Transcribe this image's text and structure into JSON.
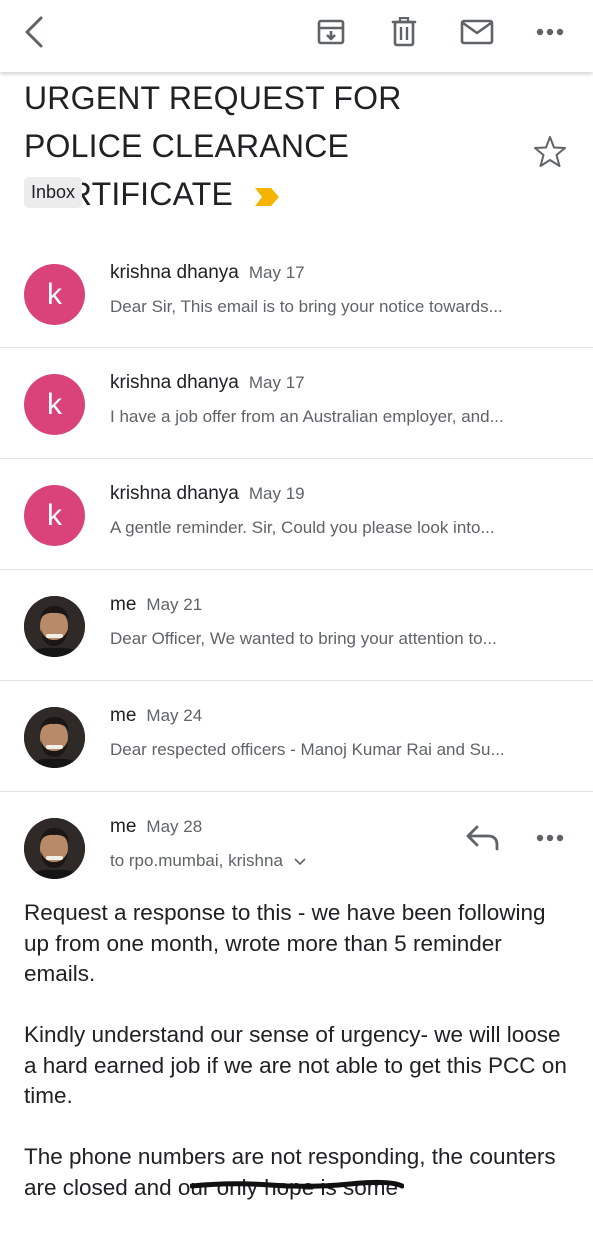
{
  "toolbar": {
    "back": "back-arrow-icon",
    "archive": "archive-icon",
    "delete": "trash-icon",
    "mark_unread": "mail-icon",
    "more": "more-horizontal-icon"
  },
  "email": {
    "subject": "URGENT REQUEST FOR POLICE CLEARANCE CERTIFICATE",
    "label": "Inbox",
    "important_color": "#f4b400",
    "avatar_color": "#d9437a"
  },
  "thread": [
    {
      "sender": "krishna dhanya",
      "date": "May 17",
      "snippet": "Dear Sir, This email is to bring your notice towards...",
      "initial": "k"
    },
    {
      "sender": "krishna dhanya",
      "date": "May 17",
      "snippet": "I have a job offer from an Australian employer, and...",
      "initial": "k"
    },
    {
      "sender": "krishna dhanya",
      "date": "May 19",
      "snippet": "A gentle reminder. Sir, Could you please look into...",
      "initial": "k"
    },
    {
      "sender": "me",
      "date": "May 21",
      "snippet": "Dear Officer, We wanted to bring your attention to...",
      "initial": ""
    },
    {
      "sender": "me",
      "date": "May 24",
      "snippet": "Dear respected officers - Manoj Kumar Rai and Su...",
      "initial": ""
    }
  ],
  "open_message": {
    "sender": "me",
    "date": "May 28",
    "recipients": "to rpo.mumbai, krishna",
    "paragraphs": [
      "Request a response to this - we have been following up from one month, wrote more than 5 reminder emails.",
      "Kindly understand our sense of urgency- we will loose a hard earned job if we are not able to get this PCC on time.",
      "The phone numbers are not responding, the counters are closed and our only hope is some"
    ]
  }
}
